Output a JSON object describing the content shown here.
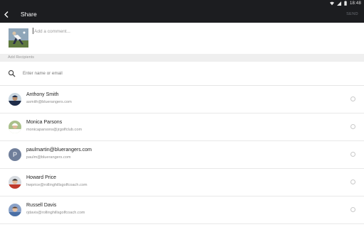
{
  "status_bar": {
    "time": "18:48"
  },
  "app_bar": {
    "title": "Share",
    "send_label": "SEND"
  },
  "compose": {
    "comment_placeholder": "Add a comment..."
  },
  "recipients": {
    "section_label": "Add Recipients",
    "search_placeholder": "Enter name or email",
    "contacts": [
      {
        "name": "Anthony Smith",
        "email": "asmith@bluerangers.com",
        "avatar": "photo"
      },
      {
        "name": "Monica Parsons",
        "email": "monicaparsons@jrgolfclub.com",
        "avatar": "photo"
      },
      {
        "name": "paulmartin@bluerangers.com",
        "email": "paulm@bluerangers.com",
        "avatar": "letter",
        "avatar_letter": "P"
      },
      {
        "name": "Howard Price",
        "email": "hwprice@rollinghillsgolfcoach.com",
        "avatar": "photo"
      },
      {
        "name": "Russell Davis",
        "email": "rjdavis@rollinghillsgolfcoach.com",
        "avatar": "photo"
      }
    ]
  },
  "colors": {
    "app_bar": "#1c1d20",
    "section_header": "#efefef",
    "letter_avatar": "#6f7e9a"
  }
}
